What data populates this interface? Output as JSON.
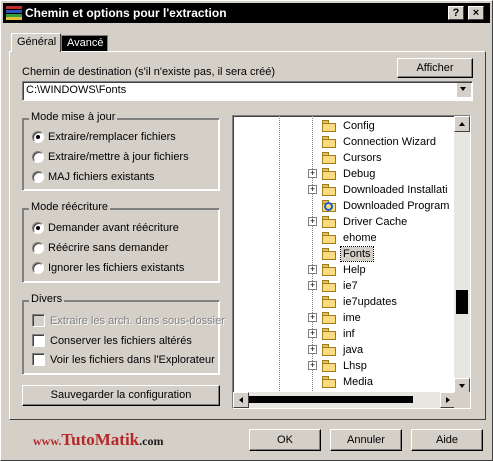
{
  "window": {
    "title": "Chemin et options pour l'extraction",
    "help_glyph": "?",
    "close_glyph": "×"
  },
  "tabs": [
    {
      "label": "Général",
      "active": true
    },
    {
      "label": "Avancé",
      "active": false
    }
  ],
  "destination": {
    "label": "Chemin de destination (s'il n'existe pas, il sera créé)",
    "value": "C:\\WINDOWS\\Fonts",
    "show_button": "Afficher"
  },
  "update_mode": {
    "title": "Mode mise à jour",
    "options": [
      {
        "label": "Extraire/remplacer fichiers",
        "checked": true
      },
      {
        "label": "Extraire/mettre à jour fichiers",
        "checked": false
      },
      {
        "label": "MAJ fichiers existants",
        "checked": false
      }
    ]
  },
  "overwrite_mode": {
    "title": "Mode réécriture",
    "options": [
      {
        "label": "Demander avant réécriture",
        "checked": true
      },
      {
        "label": "Réécrire sans demander",
        "checked": false
      },
      {
        "label": "Ignorer les fichiers existants",
        "checked": false
      }
    ]
  },
  "misc": {
    "title": "Divers",
    "options": [
      {
        "label": "Extraire les arch. dans sous-dossier",
        "checked": false,
        "disabled": true
      },
      {
        "label": "Conserver les fichiers altérés",
        "checked": false,
        "disabled": false
      },
      {
        "label": "Voir les fichiers dans l'Explorateur",
        "checked": false,
        "disabled": false
      }
    ]
  },
  "save_button": "Sauvegarder la configuration",
  "folder_tree": [
    {
      "label": "Config",
      "expandable": false,
      "selected": false
    },
    {
      "label": "Connection Wizard",
      "expandable": false,
      "selected": false
    },
    {
      "label": "Cursors",
      "expandable": false,
      "selected": false
    },
    {
      "label": "Debug",
      "expandable": true,
      "selected": false
    },
    {
      "label": "Downloaded Installati",
      "expandable": true,
      "selected": false
    },
    {
      "label": "Downloaded Program",
      "expandable": false,
      "selected": false,
      "icon": "ie-folder-icon"
    },
    {
      "label": "Driver Cache",
      "expandable": true,
      "selected": false
    },
    {
      "label": "ehome",
      "expandable": false,
      "selected": false
    },
    {
      "label": "Fonts",
      "expandable": false,
      "selected": true
    },
    {
      "label": "Help",
      "expandable": true,
      "selected": false
    },
    {
      "label": "ie7",
      "expandable": true,
      "selected": false
    },
    {
      "label": "ie7updates",
      "expandable": false,
      "selected": false
    },
    {
      "label": "ime",
      "expandable": true,
      "selected": false
    },
    {
      "label": "inf",
      "expandable": true,
      "selected": false
    },
    {
      "label": "java",
      "expandable": true,
      "selected": false
    },
    {
      "label": "Lhsp",
      "expandable": true,
      "selected": false
    },
    {
      "label": "Media",
      "expandable": false,
      "selected": false
    }
  ],
  "footer": {
    "logo_prefix": "www.",
    "logo_main": "TutoMatik",
    "logo_suffix": ".com",
    "ok_button": "OK",
    "cancel_button": "Annuler",
    "help_button": "Aide"
  },
  "colors": {
    "face": "#d4d0c8",
    "logo_red": "#b8262a",
    "logo_black": "#1a1a1a"
  }
}
